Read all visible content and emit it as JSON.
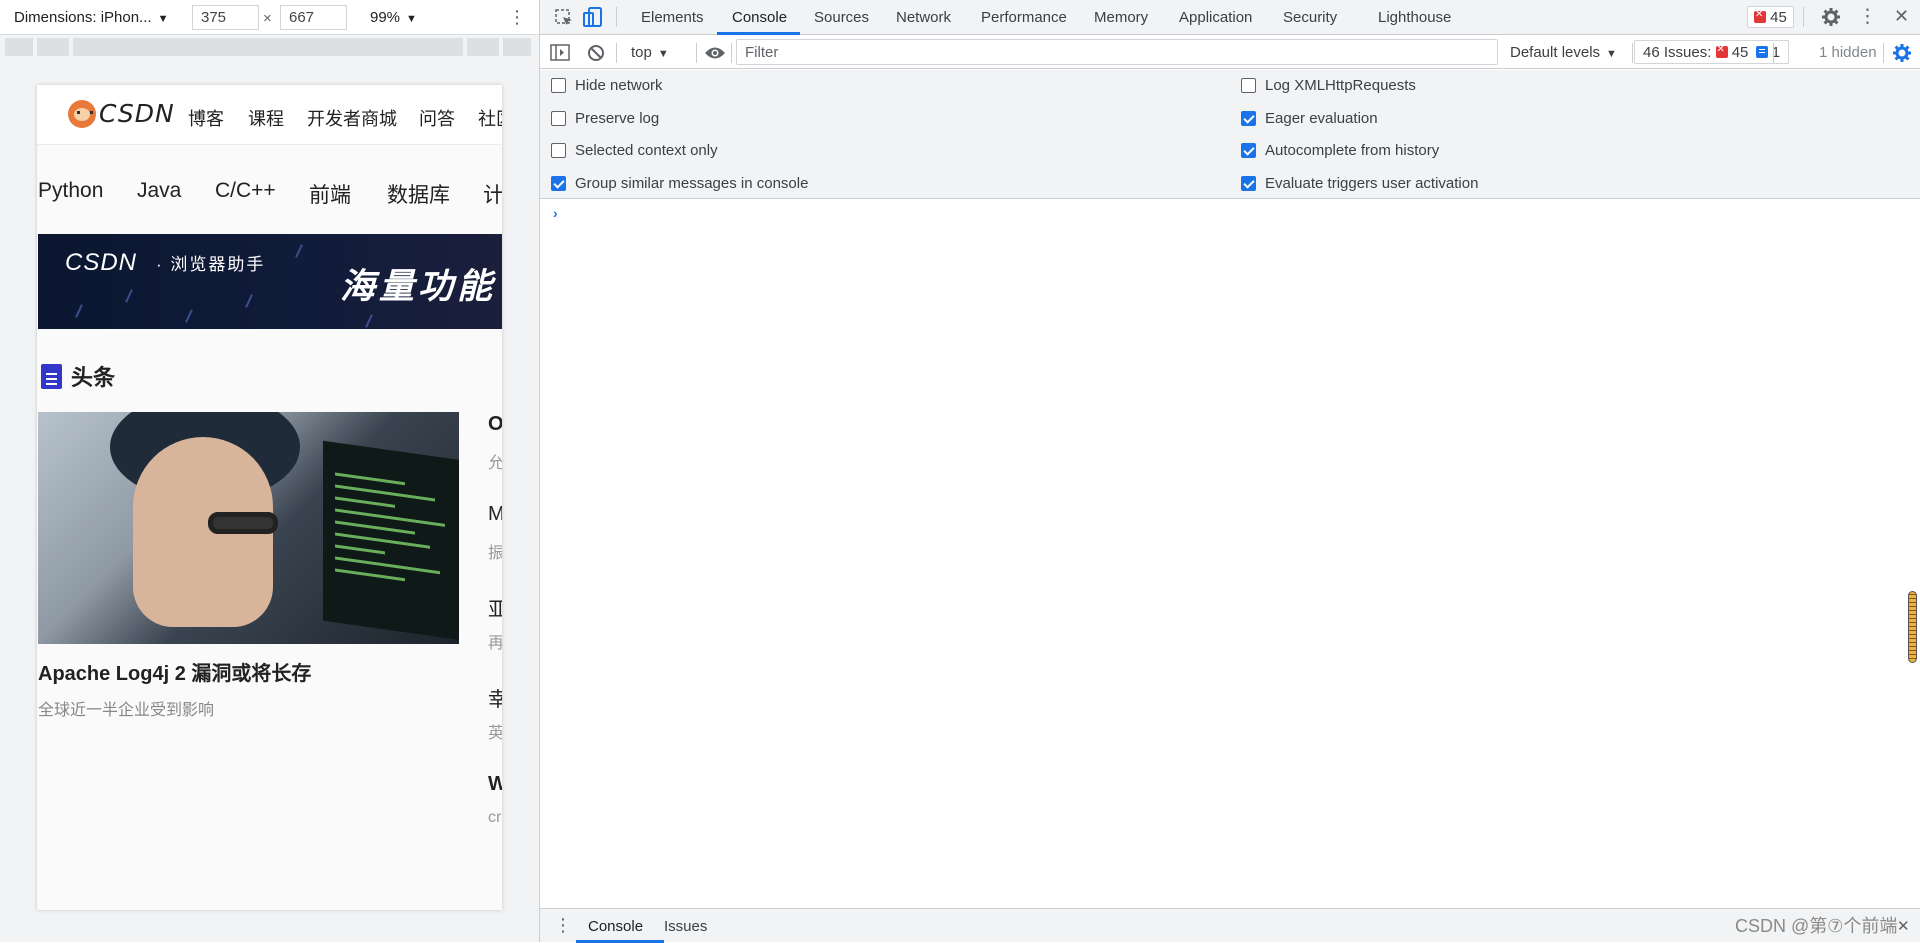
{
  "device_toolbar": {
    "device": "Dimensions: iPhon...",
    "width": "375",
    "x_sep": "×",
    "height": "667",
    "zoom": "99%"
  },
  "phone": {
    "logo_text": "CSDN",
    "nav": [
      "博客",
      "课程",
      "开发者商城",
      "问答",
      "社区"
    ],
    "categories": [
      "Python",
      "Java",
      "C/C++",
      "前端",
      "数据库",
      "计"
    ],
    "banner": {
      "brand": "CSDN",
      "subtitle": "· 浏览器助手",
      "headline": "海量功能"
    },
    "section_title": "头条",
    "article": {
      "title": "Apache Log4j 2 漏洞或将长存",
      "subtitle": "全球近一半企业受到影响"
    },
    "side_items": [
      {
        "title": "O",
        "sub": "允"
      },
      {
        "title": "M",
        "sub": "振"
      },
      {
        "title": "亚",
        "sub": "再"
      },
      {
        "title": "幸",
        "sub": "英"
      },
      {
        "title": "W",
        "sub": "cr"
      }
    ]
  },
  "devtools": {
    "tabs": [
      "Elements",
      "Console",
      "Sources",
      "Network",
      "Performance",
      "Memory",
      "Application",
      "Security",
      "Lighthouse"
    ],
    "active_tab": "Console",
    "error_count": "45",
    "context": "top",
    "filter_placeholder": "Filter",
    "levels": "Default levels",
    "issues_label": "46 Issues:",
    "issues_errors": "45",
    "issues_info": "1",
    "hidden": "1 hidden",
    "settings_left": [
      {
        "label": "Hide network",
        "checked": false
      },
      {
        "label": "Preserve log",
        "checked": false
      },
      {
        "label": "Selected context only",
        "checked": false
      },
      {
        "label": "Group similar messages in console",
        "checked": true
      }
    ],
    "settings_right": [
      {
        "label": "Log XMLHttpRequests",
        "checked": false
      },
      {
        "label": "Eager evaluation",
        "checked": true
      },
      {
        "label": "Autocomplete from history",
        "checked": true
      },
      {
        "label": "Evaluate triggers user activation",
        "checked": true
      }
    ],
    "prompt": "›",
    "drawer_tabs": [
      "Console",
      "Issues"
    ],
    "close": "✕"
  },
  "watermark": "CSDN @第⑦个前端",
  "colors": {
    "accent": "#1a73e8",
    "error": "#e3363a",
    "brand": "#fc5531"
  }
}
